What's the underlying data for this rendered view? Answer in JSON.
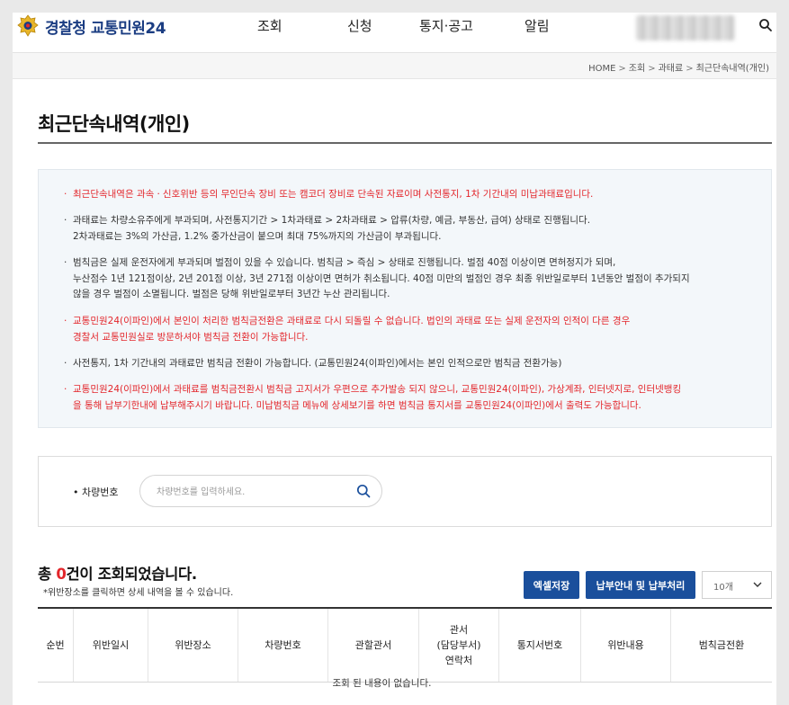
{
  "brand": {
    "name": "경찰청 교통민원24"
  },
  "nav": [
    "조회",
    "신청",
    "통지·공고",
    "알림"
  ],
  "breadcrumb": [
    "HOME",
    "조회",
    "과태료",
    "최근단속내역(개인)"
  ],
  "page_title": "최근단속내역(개인)",
  "notices": [
    {
      "text": "최근단속내역은 과속ㆍ신호위반 등의 무인단속 장비 또는 캠코더 장비로 단속된 자료이며 사전통지, 1차 기간내의 미납과태료입니다.",
      "red": true
    },
    {
      "text": "과태료는 차량소유주에게 부과되며, 사전통지기간 > 1차과태료 > 2차과태료 > 압류(차량, 예금, 부동산, 급여) 상태로 진행됩니다.\n2차과태료는 3%의 가산금, 1.2% 중가산금이 붙으며 최대 75%까지의 가산금이 부과됩니다.",
      "red": false
    },
    {
      "text": "범칙금은 실제 운전자에게 부과되며 벌점이 있을 수 있습니다. 범칙금 > 즉심 > 상태로 진행됩니다. 벌점 40점 이상이면 면허정지가 되며,\n누산점수 1년 121점이상, 2년 201점 이상, 3년 271점 이상이면 면허가 취소됩니다. 40점 미만의 벌점인 경우 최종 위반일로부터 1년동안 벌점이 추가되지\n않을 경우 벌점이 소멸됩니다. 벌점은 당해 위반일로부터 3년간 누산 관리됩니다.",
      "red": false
    },
    {
      "text": "교통민원24(이파인)에서 본인이 처리한 범칙금전환은 과태료로 다시 되돌릴 수 없습니다. 법인의 과태료 또는 실제 운전자의 인적이 다른 경우\n경찰서 교통민원실로 방문하셔야 범칙금 전환이 가능합니다.",
      "red": true
    },
    {
      "text": "사전통지, 1차 기간내의 과태료만 범칙금 전환이 가능합니다. (교통민원24(이파인)에서는 본인 인적으로만 범칙금 전환가능)",
      "red": false
    },
    {
      "text": "교통민원24(이파인)에서 과태료를 범칙금전환시 범칙금 고지서가 우편으로 추가발송 되지 않으니, 교통민원24(이파인), 가상계좌, 인터넷지로, 인터넷뱅킹\n을 통해 납부기한내에 납부해주시기 바랍니다. 미납범칙금 메뉴에 상세보기를 하면 범칙금 통지서를 교통민원24(이파인)에서 출력도 가능합니다.",
      "red": true
    }
  ],
  "search": {
    "label": "• 차량번호",
    "placeholder": "차량번호를 입력하세요.",
    "value": ""
  },
  "result": {
    "prefix": "총 ",
    "count": "0",
    "suffix": "건이 조회되었습니다.",
    "note": "*위반장소를 클릭하면 상세 내역을 볼 수 있습니다."
  },
  "buttons": {
    "excel": "엑셀저장",
    "pay": "납부안내 및 납부처리"
  },
  "page_size": {
    "selected": "10개"
  },
  "table": {
    "columns": [
      "순번",
      "위반일시",
      "위반장소",
      "차량번호",
      "관할관서",
      "관서\n(담당부서)\n연락처",
      "통지서번호",
      "위반내용",
      "범칙금전환"
    ],
    "empty_message": "조회 된 내용이 없습니다."
  },
  "colors": {
    "brand_blue": "#1a4f9c",
    "alert_red": "#e3262b",
    "logo_text": "#1b3d82"
  },
  "icons": [
    "police-emblem-icon",
    "search-icon",
    "chevron-down-icon"
  ]
}
